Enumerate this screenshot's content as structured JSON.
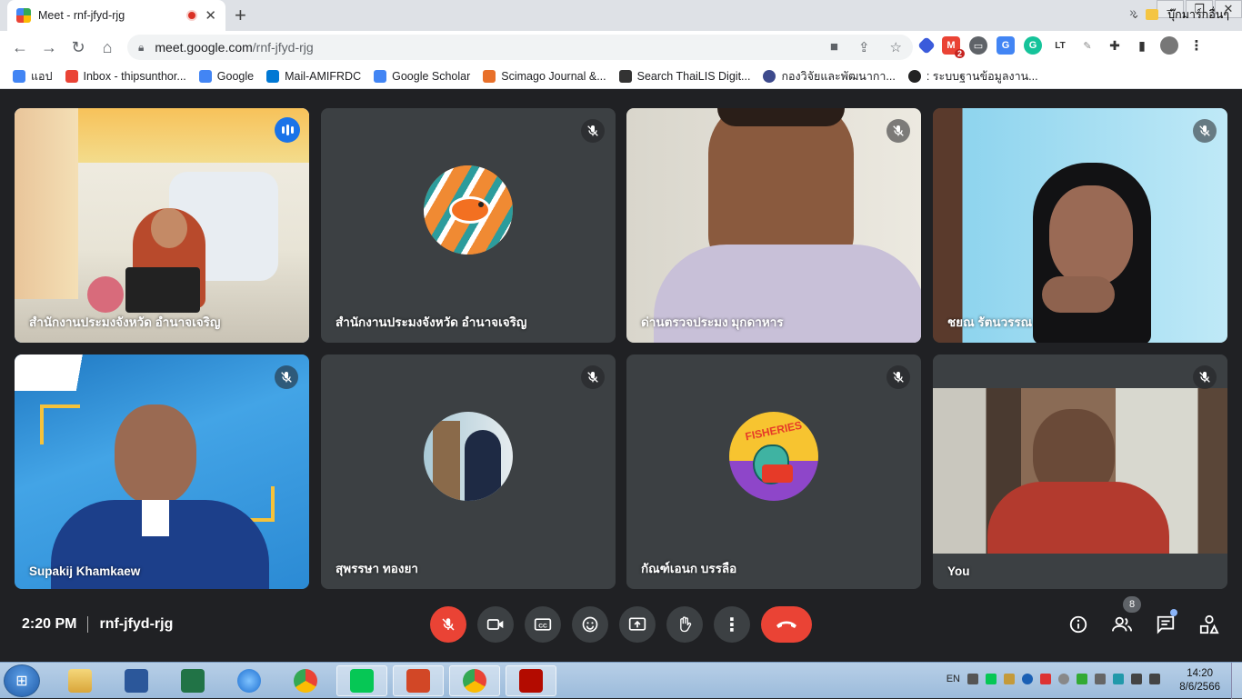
{
  "browser": {
    "tab_title": "Meet - rnf-jfyd-rjg",
    "url_host": "meet.google.com",
    "url_path": "/rnf-jfyd-rjg",
    "mail_badge": "2",
    "bookmarks": [
      {
        "label": "แอป",
        "icon": "apps-grid-icon",
        "color": "#4285f4"
      },
      {
        "label": "Inbox - thipsunthor...",
        "icon": "gmail-icon",
        "color": "#ea4335"
      },
      {
        "label": "Google",
        "icon": "google-icon",
        "color": "#4285f4"
      },
      {
        "label": "Mail-AMIFRDC",
        "icon": "outlook-icon",
        "color": "#0078d4"
      },
      {
        "label": "Google Scholar",
        "icon": "scholar-icon",
        "color": "#4285f4"
      },
      {
        "label": "Scimago Journal &...",
        "icon": "sjr-icon",
        "color": "#e8702a"
      },
      {
        "label": "Search ThaiLIS Digit...",
        "icon": "penguin-icon",
        "color": "#333333"
      },
      {
        "label": "กองวิจัยและพัฒนากา...",
        "icon": "globe-icon",
        "color": "#3d4a8c"
      },
      {
        "label": ": ระบบฐานข้อมูลงาน...",
        "icon": "world-icon",
        "color": "#222222"
      }
    ],
    "other_bookmarks": "บุ๊กมาร์กอื่นๆ"
  },
  "meet": {
    "tiles": [
      {
        "name": "สำนักงานประมงจังหวัด อำนาจเจริญ",
        "type": "video-office",
        "speaking": true
      },
      {
        "name": "สำนักงานประมงจังหวัด อำนาจเจริญ",
        "type": "avatar-fish",
        "muted": true
      },
      {
        "name": "ด่านตรวจประมง มุกดาหาร",
        "type": "video-man",
        "muted": true
      },
      {
        "name": "ชยณ รัตนวรรณ",
        "type": "video-woman",
        "muted": true
      },
      {
        "name": "Supakij Khamkaew",
        "type": "video-blue",
        "muted": true
      },
      {
        "name": "สุพรรษา ทองยา",
        "type": "avatar-photo",
        "muted": true
      },
      {
        "name": "กัณฑ์เอนก บรรลือ",
        "type": "avatar-fisheries",
        "muted": true
      },
      {
        "name": "You",
        "type": "video-self",
        "muted": true
      }
    ],
    "time": "2:20 PM",
    "meeting_code": "rnf-jfyd-rjg",
    "participants_count": "8"
  },
  "taskbar": {
    "lang": "EN",
    "time": "14:20",
    "date": "8/6/2566"
  }
}
